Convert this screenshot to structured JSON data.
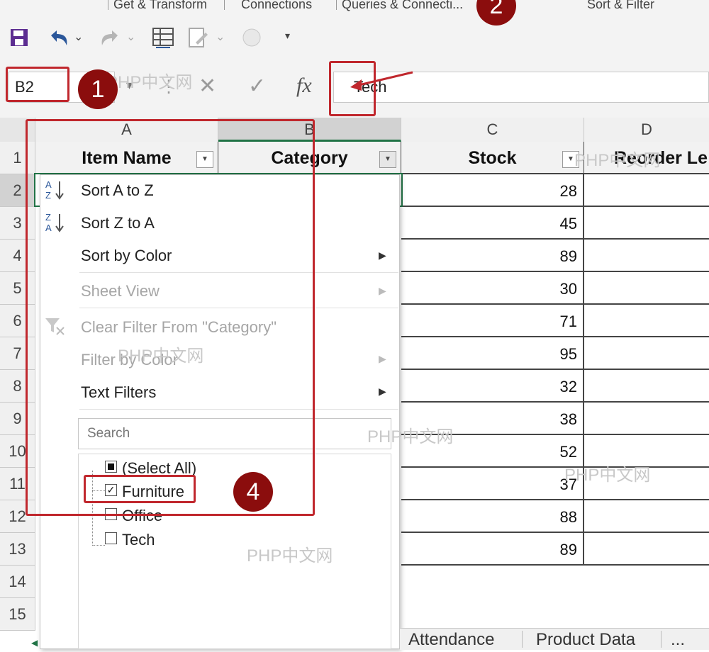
{
  "ribbon": {
    "groups": [
      "Get & Transform",
      "Connections",
      "Queries & Connecti...",
      "Sort & Filter"
    ]
  },
  "qat": {
    "icons": [
      "save-icon",
      "undo-icon",
      "redo-icon",
      "table-icon",
      "edit-icon",
      "circle-icon",
      "customize-icon"
    ]
  },
  "formula_bar": {
    "name_box": "B2",
    "fx_label": "fx",
    "formula_value": "Tech"
  },
  "grid": {
    "columns": [
      "A",
      "B",
      "C",
      "D"
    ],
    "rows": [
      "1",
      "2",
      "3",
      "4",
      "5",
      "6",
      "7",
      "8",
      "9",
      "10",
      "11",
      "12",
      "13",
      "14",
      "15"
    ],
    "header_cells": [
      "Item Name",
      "Category",
      "Stock",
      "Reorder Le"
    ],
    "stock_values": [
      "28",
      "45",
      "89",
      "30",
      "71",
      "95",
      "32",
      "38",
      "52",
      "37",
      "88",
      "89"
    ]
  },
  "filter_menu": {
    "sort_a_z": "Sort A to Z",
    "sort_z_a": "Sort Z to A",
    "sort_by_color": "Sort by Color",
    "sheet_view": "Sheet View",
    "clear_filter": "Clear Filter From \"Category\"",
    "filter_by_color": "Filter by Color",
    "text_filters": "Text Filters",
    "search_placeholder": "Search",
    "items": [
      {
        "label": "(Select All)",
        "state": "partial"
      },
      {
        "label": "Furniture",
        "state": "checked"
      },
      {
        "label": "Office",
        "state": "unchecked"
      },
      {
        "label": "Tech",
        "state": "unchecked"
      }
    ]
  },
  "annotations": {
    "badges": [
      "1",
      "2",
      "4"
    ],
    "accent_color": "#c0272d"
  },
  "watermark": "PHP中文网",
  "sheet_tabs": [
    "Attendance",
    "Product Data",
    "..."
  ]
}
